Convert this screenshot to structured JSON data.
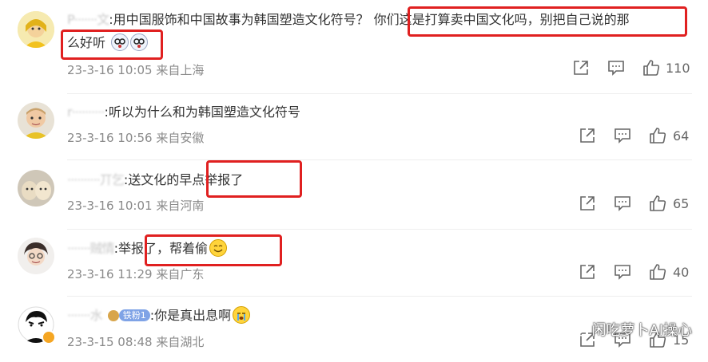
{
  "comments": [
    {
      "username": "P·······文",
      "text_part1": ":用中国服饰和中国故事为韩国塑造文化符号？",
      "text_part2": "你们这是打算卖中国文化吗，别把自己说的那",
      "text_line2": "么好听",
      "time": "23-3-16 10:05",
      "location": "来自上海",
      "likes": "110"
    },
    {
      "username": "r··········",
      "text": ":听以为什么和为韩国塑造文化符号",
      "time": "23-3-16 10:56",
      "location": "来自安徽",
      "likes": "64"
    },
    {
      "username": "··········丌乞",
      "text_part1": ":送文化",
      "text_part2": "的早点举报了",
      "time": "23-3-16 10:01",
      "location": "来自河南",
      "likes": "65"
    },
    {
      "username": "·······贼情",
      "text": ":举报了，帮着偷",
      "time": "23-3-16 11:29",
      "location": "来自广东",
      "likes": "40"
    },
    {
      "username": "·······水",
      "badge": "铁粉1",
      "text": ":你是真出息啊",
      "time": "23-3-15 08:48",
      "location": "来自湖北",
      "likes": "15"
    }
  ],
  "icons": {
    "share": "share-icon",
    "comment": "comment-icon",
    "like": "thumbs-up-icon"
  },
  "watermark": "闲吃萝卜AI操心",
  "colors": {
    "highlight_box": "#e02020",
    "meta_text": "#8a8a8a",
    "text": "#333333"
  }
}
